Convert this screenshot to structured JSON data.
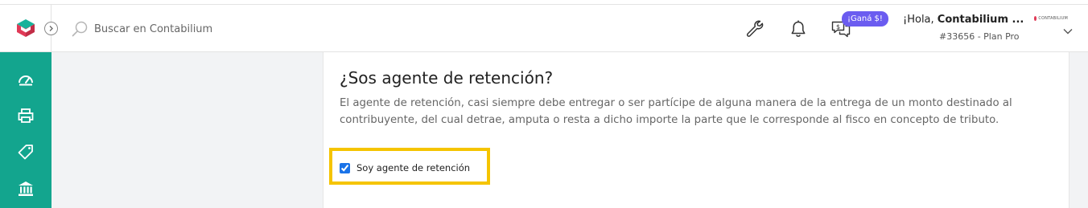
{
  "header": {
    "search_placeholder": "Buscar en Contabilium",
    "gana_badge": "¡Ganá $!",
    "user_greeting_prefix": "¡Hola, ",
    "user_name": "Contabilium ...",
    "user_plan": "#33656 - Plan Pro",
    "brand_mini_text": "CONTABILIUM"
  },
  "icons": {
    "logo": "contabilium-logo-icon",
    "expand": "chevron-right-icon",
    "search": "search-icon",
    "tools": "wrench-icon",
    "notifications": "bell-icon",
    "referral": "chat-dollar-icon",
    "user_menu": "chevron-down-icon",
    "sidebar": [
      "dashboard-icon",
      "printer-icon",
      "tag-icon",
      "bank-icon"
    ]
  },
  "colors": {
    "sidebar": "#13a58e",
    "badge": "#6b5cf0",
    "highlight": "#f5c400",
    "logo_teal": "#19b29a",
    "logo_red": "#e03a57"
  },
  "content": {
    "title": "¿Sos agente de retención?",
    "description": "El agente de retención, casi siempre debe entregar o ser partícipe de alguna manera de la entrega de un monto destinado al contribuyente, del cual detrae, amputa o resta a dicho importe la parte que le corresponde al fisco en concepto de tributo.",
    "checkbox_label": "Soy agente de retención",
    "checkbox_checked": true
  }
}
